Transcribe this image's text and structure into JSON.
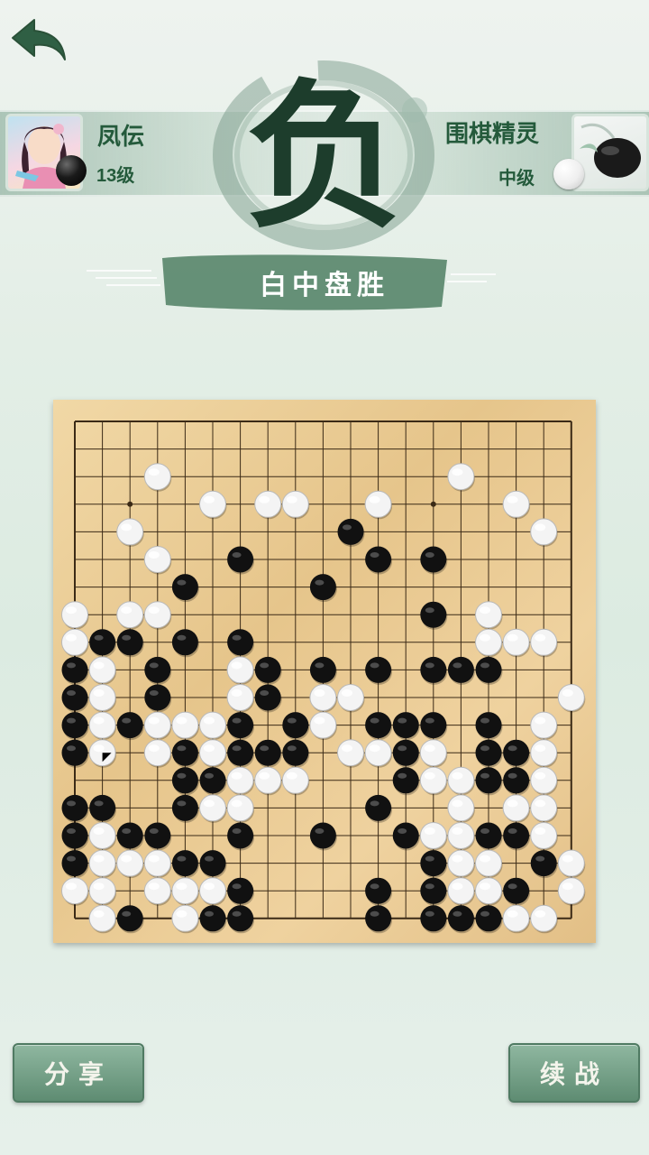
{
  "header": {
    "back_icon": "back-arrow-icon"
  },
  "player_left": {
    "name": "凤伝",
    "level": "13级",
    "stone": "black"
  },
  "player_right": {
    "name": "围棋精灵",
    "level": "中级",
    "stone": "white"
  },
  "result": {
    "verdict": "负",
    "description": "白中盘胜"
  },
  "board": {
    "size": 19,
    "colors": {
      "line": "#3b2a16",
      "black": "#111111",
      "white": "#f4f4f4"
    },
    "rows": [
      "...................",
      "...................",
      "...O..........O....",
      "..,..O.OO..O.,..O..",
      "..O.......X......O.",
      "...O..X....X.X.....",
      "....X....X.........",
      "O.OO.........X.O...",
      "OXX.X.X........OOO.",
      "XO.X..OX.X.X.XXX...",
      "XO.X..OX.OO.......O",
      "XOXOOOX.XO.XXX.X.O.",
      "XO.OXOXXX.OOXO.XXO.",
      "....XXOOO...XOOXXO.",
      "XX..XOO....X..O.OO.",
      "XOXX..X..X..XOOXXO.",
      "XOOOXX.......XOO.XO",
      "OO.OOOX....X.XOOX.O",
      ".OX.OXX....X.XXXOO."
    ],
    "last_move": {
      "row": 12,
      "col": 1
    }
  },
  "buttons": {
    "share": "分享",
    "continue": "续战"
  }
}
